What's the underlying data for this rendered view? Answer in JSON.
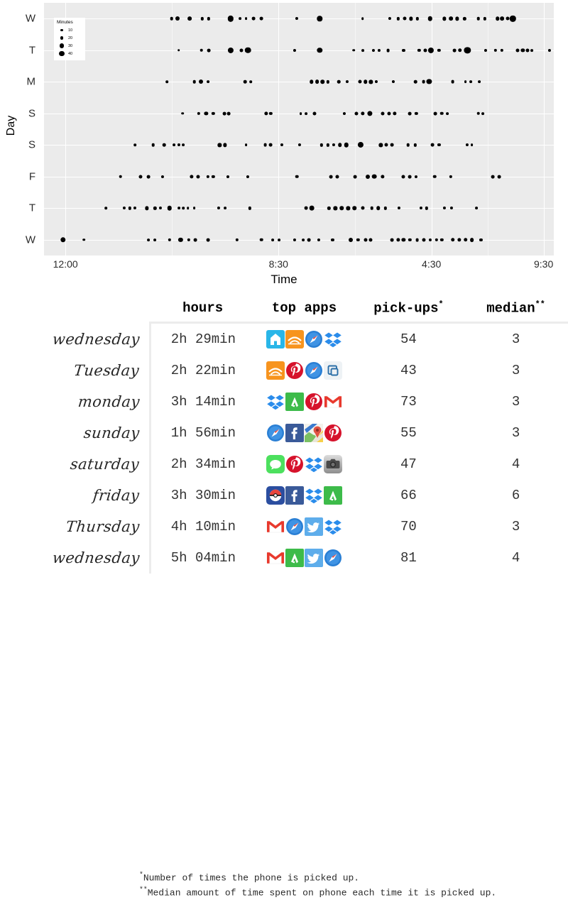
{
  "chart_data": {
    "type": "scatter",
    "title": "",
    "xlabel": "Time",
    "ylabel": "Day",
    "size_legend": {
      "title": "Minutes",
      "breaks": [
        10,
        20,
        30,
        40
      ]
    },
    "grid": true,
    "panel_background": "#ebebeb",
    "point_color": "#000000",
    "x_tick_labels": [
      "12:00",
      "8:30",
      "4:30",
      "9:30"
    ],
    "x_tick_positions_pct": [
      4.2,
      46.0,
      76.0,
      98.0
    ],
    "y_tick_labels": [
      "W",
      "T",
      "M",
      "S",
      "S",
      "F",
      "T",
      "W"
    ],
    "series": [
      {
        "name": "W",
        "points": [
          {
            "t": 28.0,
            "m": 10
          },
          {
            "t": 29.4,
            "m": 16
          },
          {
            "t": 32.0,
            "m": 15
          },
          {
            "t": 34.8,
            "m": 9
          },
          {
            "t": 36.2,
            "m": 9
          },
          {
            "t": 41.0,
            "m": 26
          },
          {
            "t": 43.0,
            "m": 7
          },
          {
            "t": 44.4,
            "m": 7
          },
          {
            "t": 46.0,
            "m": 11
          },
          {
            "t": 47.8,
            "m": 11
          },
          {
            "t": 55.5,
            "m": 8
          },
          {
            "t": 60.6,
            "m": 22
          },
          {
            "t": 70.0,
            "m": 6
          },
          {
            "t": 76.0,
            "m": 8
          },
          {
            "t": 77.8,
            "m": 9
          },
          {
            "t": 79.2,
            "m": 12
          },
          {
            "t": 80.6,
            "m": 13
          },
          {
            "t": 82.0,
            "m": 9
          },
          {
            "t": 84.8,
            "m": 18
          },
          {
            "t": 88.0,
            "m": 13
          },
          {
            "t": 89.4,
            "m": 15
          },
          {
            "t": 90.8,
            "m": 13
          },
          {
            "t": 92.4,
            "m": 9
          },
          {
            "t": 95.4,
            "m": 10
          },
          {
            "t": 96.8,
            "m": 9
          },
          {
            "t": 99.6,
            "m": 14
          },
          {
            "t": 100.6,
            "m": 15
          },
          {
            "t": 101.8,
            "m": 12
          },
          {
            "t": 103.0,
            "m": 26
          }
        ]
      },
      {
        "name": "T",
        "points": [
          {
            "t": 29.6,
            "m": 6
          },
          {
            "t": 34.6,
            "m": 10
          },
          {
            "t": 36.2,
            "m": 11
          },
          {
            "t": 41.0,
            "m": 25
          },
          {
            "t": 43.4,
            "m": 12
          },
          {
            "t": 44.8,
            "m": 27
          },
          {
            "t": 55.0,
            "m": 8
          },
          {
            "t": 60.6,
            "m": 22
          },
          {
            "t": 68.0,
            "m": 6
          },
          {
            "t": 70.0,
            "m": 7
          },
          {
            "t": 72.4,
            "m": 8
          },
          {
            "t": 73.6,
            "m": 8
          },
          {
            "t": 75.6,
            "m": 11
          },
          {
            "t": 79.0,
            "m": 8
          },
          {
            "t": 82.4,
            "m": 9
          },
          {
            "t": 83.8,
            "m": 12
          },
          {
            "t": 85.0,
            "m": 25
          },
          {
            "t": 86.8,
            "m": 9
          },
          {
            "t": 90.2,
            "m": 11
          },
          {
            "t": 91.4,
            "m": 14
          },
          {
            "t": 93.0,
            "m": 30
          },
          {
            "t": 97.0,
            "m": 8
          },
          {
            "t": 99.2,
            "m": 9
          },
          {
            "t": 100.6,
            "m": 9
          },
          {
            "t": 104.0,
            "m": 12
          },
          {
            "t": 105.2,
            "m": 13
          },
          {
            "t": 106.2,
            "m": 12
          },
          {
            "t": 107.2,
            "m": 7
          },
          {
            "t": 111.0,
            "m": 8
          }
        ]
      },
      {
        "name": "M",
        "points": [
          {
            "t": 27.0,
            "m": 6
          },
          {
            "t": 33.0,
            "m": 10
          },
          {
            "t": 34.4,
            "m": 16
          },
          {
            "t": 36.0,
            "m": 7
          },
          {
            "t": 44.2,
            "m": 10
          },
          {
            "t": 45.4,
            "m": 6
          },
          {
            "t": 58.8,
            "m": 14
          },
          {
            "t": 60.0,
            "m": 15
          },
          {
            "t": 61.2,
            "m": 14
          },
          {
            "t": 62.4,
            "m": 9
          },
          {
            "t": 64.8,
            "m": 10
          },
          {
            "t": 66.6,
            "m": 8
          },
          {
            "t": 69.4,
            "m": 12
          },
          {
            "t": 70.6,
            "m": 14
          },
          {
            "t": 71.8,
            "m": 13
          },
          {
            "t": 73.0,
            "m": 8
          },
          {
            "t": 76.8,
            "m": 8
          },
          {
            "t": 81.6,
            "m": 10
          },
          {
            "t": 83.4,
            "m": 11
          },
          {
            "t": 84.6,
            "m": 21
          },
          {
            "t": 89.8,
            "m": 11
          },
          {
            "t": 92.6,
            "m": 7
          },
          {
            "t": 93.8,
            "m": 7
          },
          {
            "t": 95.6,
            "m": 7
          }
        ]
      },
      {
        "name": "S",
        "points": [
          {
            "t": 30.4,
            "m": 6
          },
          {
            "t": 34.0,
            "m": 9
          },
          {
            "t": 35.6,
            "m": 13
          },
          {
            "t": 37.2,
            "m": 9
          },
          {
            "t": 39.6,
            "m": 11
          },
          {
            "t": 40.6,
            "m": 11
          },
          {
            "t": 48.8,
            "m": 13
          },
          {
            "t": 49.8,
            "m": 9
          },
          {
            "t": 56.4,
            "m": 7
          },
          {
            "t": 57.6,
            "m": 7
          },
          {
            "t": 59.4,
            "m": 12
          },
          {
            "t": 66.0,
            "m": 8
          },
          {
            "t": 68.6,
            "m": 12
          },
          {
            "t": 70.0,
            "m": 13
          },
          {
            "t": 71.6,
            "m": 21
          },
          {
            "t": 74.4,
            "m": 12
          },
          {
            "t": 75.8,
            "m": 12
          },
          {
            "t": 77.0,
            "m": 13
          },
          {
            "t": 80.4,
            "m": 11
          },
          {
            "t": 81.8,
            "m": 9
          },
          {
            "t": 86.0,
            "m": 11
          },
          {
            "t": 87.4,
            "m": 10
          },
          {
            "t": 88.6,
            "m": 7
          },
          {
            "t": 95.4,
            "m": 10
          },
          {
            "t": 96.4,
            "m": 7
          }
        ]
      },
      {
        "name": "S",
        "points": [
          {
            "t": 20.0,
            "m": 6
          },
          {
            "t": 24.0,
            "m": 10
          },
          {
            "t": 26.4,
            "m": 10
          },
          {
            "t": 28.6,
            "m": 7
          },
          {
            "t": 29.6,
            "m": 8
          },
          {
            "t": 30.6,
            "m": 7
          },
          {
            "t": 38.6,
            "m": 13
          },
          {
            "t": 39.8,
            "m": 13
          },
          {
            "t": 44.4,
            "m": 7
          },
          {
            "t": 48.6,
            "m": 11
          },
          {
            "t": 49.8,
            "m": 11
          },
          {
            "t": 52.2,
            "m": 8
          },
          {
            "t": 56.2,
            "m": 8
          },
          {
            "t": 61.0,
            "m": 9
          },
          {
            "t": 62.4,
            "m": 9
          },
          {
            "t": 63.6,
            "m": 8
          },
          {
            "t": 65.0,
            "m": 14
          },
          {
            "t": 66.4,
            "m": 18
          },
          {
            "t": 69.6,
            "m": 25
          },
          {
            "t": 74.0,
            "m": 13
          },
          {
            "t": 75.2,
            "m": 12
          },
          {
            "t": 76.4,
            "m": 11
          },
          {
            "t": 80.0,
            "m": 10
          },
          {
            "t": 81.6,
            "m": 9
          },
          {
            "t": 85.4,
            "m": 11
          },
          {
            "t": 86.8,
            "m": 8
          },
          {
            "t": 93.0,
            "m": 8
          },
          {
            "t": 94.0,
            "m": 7
          }
        ]
      },
      {
        "name": "F",
        "points": [
          {
            "t": 16.8,
            "m": 10
          },
          {
            "t": 21.2,
            "m": 12
          },
          {
            "t": 23.0,
            "m": 11
          },
          {
            "t": 26.0,
            "m": 8
          },
          {
            "t": 32.4,
            "m": 13
          },
          {
            "t": 33.8,
            "m": 12
          },
          {
            "t": 36.0,
            "m": 9
          },
          {
            "t": 37.2,
            "m": 9
          },
          {
            "t": 40.4,
            "m": 8
          },
          {
            "t": 44.8,
            "m": 8
          },
          {
            "t": 55.6,
            "m": 10
          },
          {
            "t": 63.0,
            "m": 11
          },
          {
            "t": 64.4,
            "m": 12
          },
          {
            "t": 68.4,
            "m": 11
          },
          {
            "t": 71.2,
            "m": 16
          },
          {
            "t": 72.6,
            "m": 19
          },
          {
            "t": 74.4,
            "m": 13
          },
          {
            "t": 79.0,
            "m": 12
          },
          {
            "t": 80.4,
            "m": 11
          },
          {
            "t": 81.8,
            "m": 8
          },
          {
            "t": 85.8,
            "m": 10
          },
          {
            "t": 89.4,
            "m": 9
          },
          {
            "t": 98.6,
            "m": 11
          },
          {
            "t": 100.0,
            "m": 11
          }
        ]
      },
      {
        "name": "T",
        "points": [
          {
            "t": 13.6,
            "m": 6
          },
          {
            "t": 17.6,
            "m": 8
          },
          {
            "t": 18.8,
            "m": 9
          },
          {
            "t": 20.0,
            "m": 8
          },
          {
            "t": 22.6,
            "m": 13
          },
          {
            "t": 24.4,
            "m": 9
          },
          {
            "t": 25.6,
            "m": 8
          },
          {
            "t": 27.6,
            "m": 18
          },
          {
            "t": 29.6,
            "m": 7
          },
          {
            "t": 30.6,
            "m": 6
          },
          {
            "t": 31.6,
            "m": 6
          },
          {
            "t": 33.0,
            "m": 7
          },
          {
            "t": 38.4,
            "m": 8
          },
          {
            "t": 39.8,
            "m": 7
          },
          {
            "t": 45.2,
            "m": 9
          },
          {
            "t": 57.6,
            "m": 11
          },
          {
            "t": 58.8,
            "m": 19
          },
          {
            "t": 62.6,
            "m": 9
          },
          {
            "t": 64.0,
            "m": 13
          },
          {
            "t": 65.4,
            "m": 14
          },
          {
            "t": 66.8,
            "m": 13
          },
          {
            "t": 68.2,
            "m": 14
          },
          {
            "t": 70.0,
            "m": 12
          },
          {
            "t": 72.0,
            "m": 10
          },
          {
            "t": 73.4,
            "m": 14
          },
          {
            "t": 75.0,
            "m": 9
          },
          {
            "t": 78.0,
            "m": 8
          },
          {
            "t": 82.8,
            "m": 8
          },
          {
            "t": 84.0,
            "m": 9
          },
          {
            "t": 88.0,
            "m": 8
          },
          {
            "t": 89.6,
            "m": 8
          },
          {
            "t": 95.0,
            "m": 7
          }
        ]
      },
      {
        "name": "W",
        "points": [
          {
            "t": 4.2,
            "m": 22
          },
          {
            "t": 8.8,
            "m": 6
          },
          {
            "t": 23.0,
            "m": 7
          },
          {
            "t": 24.4,
            "m": 7
          },
          {
            "t": 27.6,
            "m": 9
          },
          {
            "t": 30.0,
            "m": 17
          },
          {
            "t": 31.8,
            "m": 9
          },
          {
            "t": 33.2,
            "m": 11
          },
          {
            "t": 36.0,
            "m": 11
          },
          {
            "t": 42.4,
            "m": 9
          },
          {
            "t": 47.8,
            "m": 10
          },
          {
            "t": 50.2,
            "m": 7
          },
          {
            "t": 51.6,
            "m": 7
          },
          {
            "t": 55.0,
            "m": 8
          },
          {
            "t": 57.0,
            "m": 7
          },
          {
            "t": 58.2,
            "m": 11
          },
          {
            "t": 60.4,
            "m": 8
          },
          {
            "t": 63.4,
            "m": 8
          },
          {
            "t": 67.4,
            "m": 16
          },
          {
            "t": 69.0,
            "m": 9
          },
          {
            "t": 70.6,
            "m": 12
          },
          {
            "t": 71.8,
            "m": 12
          },
          {
            "t": 76.4,
            "m": 11
          },
          {
            "t": 77.8,
            "m": 13
          },
          {
            "t": 79.0,
            "m": 13
          },
          {
            "t": 80.4,
            "m": 9
          },
          {
            "t": 82.0,
            "m": 11
          },
          {
            "t": 83.4,
            "m": 12
          },
          {
            "t": 84.8,
            "m": 8
          },
          {
            "t": 86.2,
            "m": 9
          },
          {
            "t": 87.4,
            "m": 9
          },
          {
            "t": 89.8,
            "m": 14
          },
          {
            "t": 91.2,
            "m": 13
          },
          {
            "t": 92.6,
            "m": 14
          },
          {
            "t": 94.0,
            "m": 15
          },
          {
            "t": 96.0,
            "m": 8
          }
        ]
      }
    ]
  },
  "table": {
    "headers": {
      "day": "",
      "hours": "hours",
      "apps": "top apps",
      "pickups": "pick-ups",
      "pickups_sup": "*",
      "median": "median",
      "median_sup": "**"
    },
    "rows": [
      {
        "day": "wednesday",
        "hours": "2h 29min",
        "pickups": "54",
        "median": "3",
        "apps": [
          "nest-icon",
          "audible-icon",
          "safari-icon",
          "dropbox-icon"
        ]
      },
      {
        "day": "Tuesday",
        "hours": "2h 22min",
        "pickups": "43",
        "median": "3",
        "apps": [
          "audible-icon",
          "pinterest-icon",
          "safari-icon",
          "app-switcher-icon"
        ]
      },
      {
        "day": "monday",
        "hours": "3h 14min",
        "pickups": "73",
        "median": "3",
        "apps": [
          "dropbox-icon",
          "feedly-icon",
          "pinterest-icon",
          "gmail-icon"
        ]
      },
      {
        "day": "sunday",
        "hours": "1h 56min",
        "pickups": "55",
        "median": "3",
        "apps": [
          "safari-icon",
          "facebook-icon",
          "google-maps-icon",
          "pinterest-icon"
        ]
      },
      {
        "day": "saturday",
        "hours": "2h 34min",
        "pickups": "47",
        "median": "4",
        "apps": [
          "messages-icon",
          "pinterest-icon",
          "dropbox-icon",
          "camera-icon"
        ]
      },
      {
        "day": "friday",
        "hours": "3h 30min",
        "pickups": "66",
        "median": "6",
        "apps": [
          "pokemon-go-icon",
          "facebook-icon",
          "dropbox-icon",
          "feedly-icon"
        ]
      },
      {
        "day": "Thursday",
        "hours": "4h 10min",
        "pickups": "70",
        "median": "3",
        "apps": [
          "gmail-icon",
          "safari-icon",
          "twitter-icon",
          "dropbox-icon"
        ]
      },
      {
        "day": "wednesday",
        "hours": "5h 04min",
        "pickups": "81",
        "median": "4",
        "apps": [
          "gmail-icon",
          "feedly-icon",
          "twitter-icon",
          "safari-icon"
        ]
      }
    ]
  },
  "footnotes": {
    "one_marker": "*",
    "one": "Number of times the phone is picked up.",
    "two_marker": "**",
    "two": "Median amount of time spent on phone each time it is picked up."
  }
}
